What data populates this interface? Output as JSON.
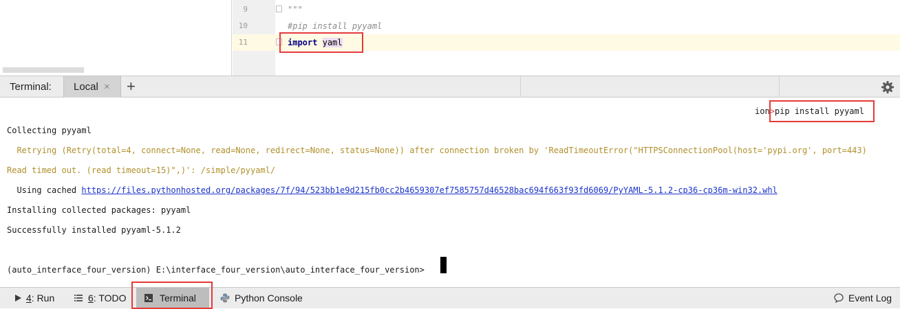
{
  "editor": {
    "lines": [
      {
        "number": "9",
        "text": "\"\"\""
      },
      {
        "number": "10",
        "text": "#pip install pyyaml"
      },
      {
        "number": "11",
        "keyword": "import",
        "module": "yaml"
      }
    ]
  },
  "terminal": {
    "title": "Terminal:",
    "tab_label": "Local",
    "tab_close": "×",
    "add_label": "+",
    "settings_icon": "gear-icon"
  },
  "output": {
    "command_tail": "ion",
    "command_prompt": ">",
    "command": "pip install pyyaml",
    "collecting": "Collecting pyyaml",
    "retry_line1": "  Retrying (Retry(total=4, connect=None, read=None, redirect=None, status=None)) after connection broken by 'ReadTimeoutError(\"HTTPSConnectionPool(host='pypi.org', port=443)",
    "retry_line2": "Read timed out. (read timeout=15)\",)': /simple/pyyaml/",
    "cached_prefix": "  Using cached ",
    "cached_url": "https://files.pythonhosted.org/packages/7f/94/523bb1e9d215fb0cc2b4659307ef7585757d46528bac694f663f93fd6069/PyYAML-5.1.2-cp36-cp36m-win32.whl",
    "installing": "Installing collected packages: pyyaml",
    "success": "Successfully installed pyyaml-5.1.2",
    "prompt": "(auto_interface_four_version) E:\\interface_four_version\\auto_interface_four_version>"
  },
  "toolbar": {
    "run": {
      "mnemonic": "4",
      "label": ": Run"
    },
    "todo": {
      "mnemonic": "6",
      "label": ": TODO"
    },
    "terminal": {
      "label": "Terminal"
    },
    "python_console": {
      "label": "Python Console"
    },
    "event_log": {
      "label": "Event Log"
    }
  },
  "colors": {
    "highlight_box": "#e53935",
    "warning_text": "#b0902c",
    "link": "#1a33c9",
    "keyword": "#000080"
  }
}
